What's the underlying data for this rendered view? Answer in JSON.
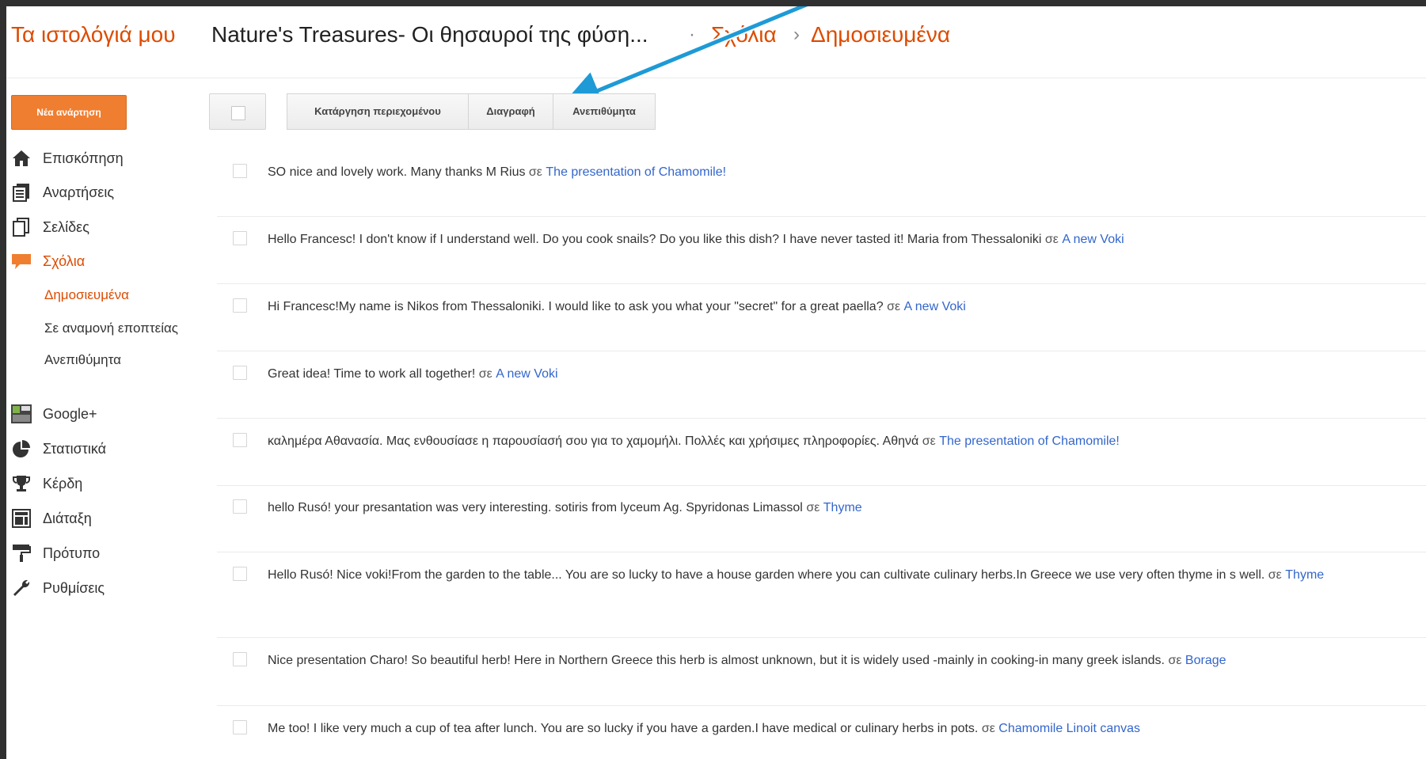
{
  "header": {
    "brand": "Τα ιστολόγιά μου",
    "blog_title": "Nature's Treasures- Οι θησαυροί της φύση...",
    "sep1": "·",
    "crumb_comments": "Σχόλια",
    "sep2": "›",
    "crumb_published": "Δημοσιευμένα"
  },
  "sidebar": {
    "new_post": "Νέα ανάρτηση",
    "items": [
      {
        "label": "Επισκόπηση",
        "icon": "home-icon"
      },
      {
        "label": "Αναρτήσεις",
        "icon": "posts-icon"
      },
      {
        "label": "Σελίδες",
        "icon": "pages-icon"
      },
      {
        "label": "Σχόλια",
        "icon": "comments-icon"
      }
    ],
    "sub_items": [
      {
        "label": "Δημοσιευμένα"
      },
      {
        "label": "Σε αναμονή εποπτείας"
      },
      {
        "label": "Ανεπιθύμητα"
      }
    ],
    "items2": [
      {
        "label": "Google+",
        "icon": "google-plus-icon"
      },
      {
        "label": "Στατιστικά",
        "icon": "stats-icon"
      },
      {
        "label": "Κέρδη",
        "icon": "trophy-icon"
      },
      {
        "label": "Διάταξη",
        "icon": "layout-icon"
      },
      {
        "label": "Πρότυπο",
        "icon": "paint-roller-icon"
      },
      {
        "label": "Ρυθμίσεις",
        "icon": "wrench-icon"
      }
    ]
  },
  "toolbar": {
    "remove_content": "Κατάργηση περιεχομένου",
    "delete": "Διαγραφή",
    "spam": "Ανεπιθύμητα"
  },
  "colors": {
    "accent": "#dd4b00",
    "link": "#3366cc",
    "arrow": "#1e9ad6"
  },
  "comments": [
    {
      "text": "SO nice and lovely work. Many thanks M Rius",
      "on": "σε",
      "post": "The presentation of Chamomile!"
    },
    {
      "text": "Hello Francesc! I don't know if I understand well. Do you cook snails? Do you like this dish? I have never tasted it! Maria from Thessaloniki",
      "on": "σε",
      "post": "A new Voki"
    },
    {
      "text": "Hi Francesc!My name is Nikos from Thessaloniki. I would like to ask you what your \"secret\" for a great paella?",
      "on": "σε",
      "post": "A new Voki"
    },
    {
      "text": "Great idea! Time to work all together!",
      "on": "σε",
      "post": "A new Voki"
    },
    {
      "text": "καλημέρα Αθανασία. Μας ενθουσίασε η παρουσίασή σου για το χαμομήλι. Πολλές και χρήσιμες πληροφορίες. Αθηνά",
      "on": "σε",
      "post": "The presentation of Chamomile!"
    },
    {
      "text": "hello Rusó! your presantation was very interesting. sotiris from lyceum Ag. Spyridonas Limassol",
      "on": "σε",
      "post": "Thyme"
    },
    {
      "text": "Hello Rusó! Nice voki!From the garden to the table... You are so lucky to have a house garden where you can cultivate culinary herbs.In Greece we use very often thyme in s well.",
      "on": "σε",
      "post": "Thyme"
    },
    {
      "text": "Nice presentation Charo! So beautiful herb! Here in Northern Greece this herb is almost unknown, but it is widely used -mainly in cooking-in many greek islands.",
      "on": "σε",
      "post": "Borage"
    },
    {
      "text": "Me too! I like very much a cup of tea after lunch. You are so lucky if you have a garden.I have medical or culinary herbs in pots.",
      "on": "σε",
      "post": "Chamomile Linoit canvas"
    }
  ]
}
